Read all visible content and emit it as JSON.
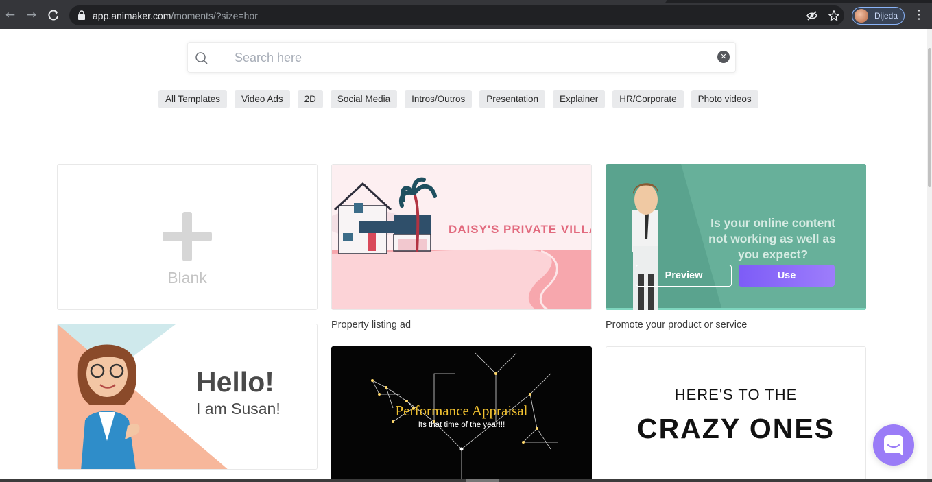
{
  "browser": {
    "url_host": "app.animaker.com",
    "url_path": "/moments/?size=hor",
    "profile_name": "Dijeda",
    "icons": [
      "back-arrow-icon",
      "forward-arrow-icon",
      "reload-icon",
      "lock-icon",
      "eye-off-icon",
      "star-icon",
      "more-vert-icon"
    ]
  },
  "search": {
    "placeholder": "Search here"
  },
  "categories": [
    {
      "label": "All Templates"
    },
    {
      "label": "Video Ads"
    },
    {
      "label": "2D"
    },
    {
      "label": "Social Media"
    },
    {
      "label": "Intros/Outros"
    },
    {
      "label": "Presentation"
    },
    {
      "label": "Explainer"
    },
    {
      "label": "HR/Corporate"
    },
    {
      "label": "Photo videos"
    }
  ],
  "cards": {
    "blank": {
      "label": "Blank"
    },
    "villa": {
      "title_text": "DAISY'S PRIVATE VILLA",
      "caption": "Property listing ad"
    },
    "promote": {
      "line1": "Is your online content",
      "line2": "not working as well as",
      "line3": "you expect?",
      "caption": "Promote your product or service",
      "preview_label": "Preview",
      "use_label": "Use"
    },
    "susan": {
      "hello": "Hello!",
      "sub": "I am Susan!"
    },
    "appraisal": {
      "title": "Performance Appraisal",
      "sub": "Its that time of the year!!!"
    },
    "crazy": {
      "line1": "HERE'S TO THE",
      "line2": "CRAZY ONES"
    }
  },
  "colors": {
    "accent": "#8b6cf9",
    "promote_bg": "#5aa38e",
    "villa_text": "#e26a7e"
  },
  "chat_launcher": {
    "icon": "chat-bubble-icon"
  }
}
